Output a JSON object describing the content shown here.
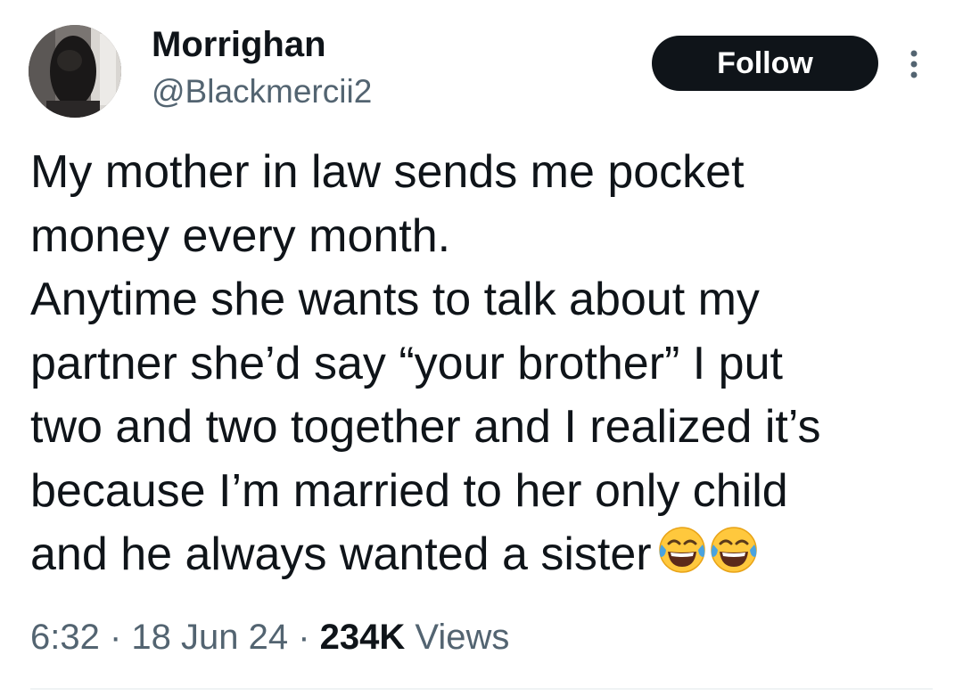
{
  "author": {
    "display_name": "Morrighan",
    "handle": "@Blackmercii2",
    "avatar_icon": "profile-photo"
  },
  "actions": {
    "follow_label": "Follow",
    "more_icon": "more-vertical-icon"
  },
  "tweet": {
    "lines": [
      "My mother in law sends me pocket",
      "money every month.",
      "Anytime she wants to talk about my",
      "partner she’d say “your brother” I put",
      "two and two together and I realized it’s",
      "because I’m married to her only child",
      "and he always wanted a sister"
    ],
    "emojis": [
      "face-with-tears-of-joy",
      "face-with-tears-of-joy"
    ]
  },
  "meta": {
    "time": "6:32",
    "separator1": " · ",
    "date": "18 Jun 24",
    "separator2": " · ",
    "views_count": "234K",
    "views_label": " Views"
  },
  "colors": {
    "text_primary": "#0f1419",
    "text_secondary": "#536471",
    "button_bg": "#0f1419",
    "button_text": "#ffffff",
    "emoji_face": "#ffc83d",
    "emoji_tears": "#4aa3df"
  }
}
